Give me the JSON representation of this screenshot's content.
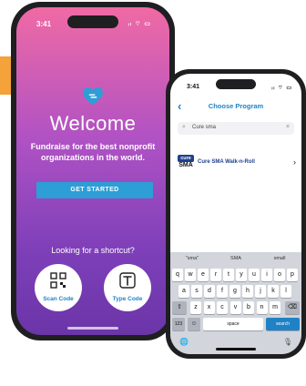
{
  "colors": {
    "accent": "#f4a23a",
    "brand_blue": "#1f82c7",
    "button_blue": "#2d9ed6"
  },
  "phone1": {
    "status_time": "3:41",
    "status_icons": "ᵢₗ ⌔ ▭",
    "logo_icon": "heart-logo-icon",
    "welcome": "Welcome",
    "tagline": "Fundraise for the best nonprofit organizations in the world.",
    "get_started": "GET STARTED",
    "shortcut": "Looking for a shortcut?",
    "scan_label": "Scan Code",
    "type_label": "Type Code"
  },
  "phone2": {
    "status_time": "3:41",
    "status_icons": "ᵢₗ ⌔ ▭",
    "title": "Choose Program",
    "search_value": "Cure sma",
    "result": {
      "logo_top": "cure",
      "logo_bottom": "SMA",
      "label": "Cure SMA Walk-n-Roll"
    },
    "suggestions": [
      "\"sma\"",
      "SMA",
      "small"
    ],
    "row1": [
      "q",
      "w",
      "e",
      "r",
      "t",
      "y",
      "u",
      "i",
      "o",
      "p"
    ],
    "row2": [
      "a",
      "s",
      "d",
      "f",
      "g",
      "h",
      "j",
      "k",
      "l"
    ],
    "row3": [
      "z",
      "x",
      "c",
      "v",
      "b",
      "n",
      "m"
    ],
    "shift": "⇧",
    "backspace": "⌫",
    "numbers": "123",
    "emoji": "☺",
    "space": "space",
    "search": "search",
    "globe": "🌐",
    "mic": "🎙"
  }
}
